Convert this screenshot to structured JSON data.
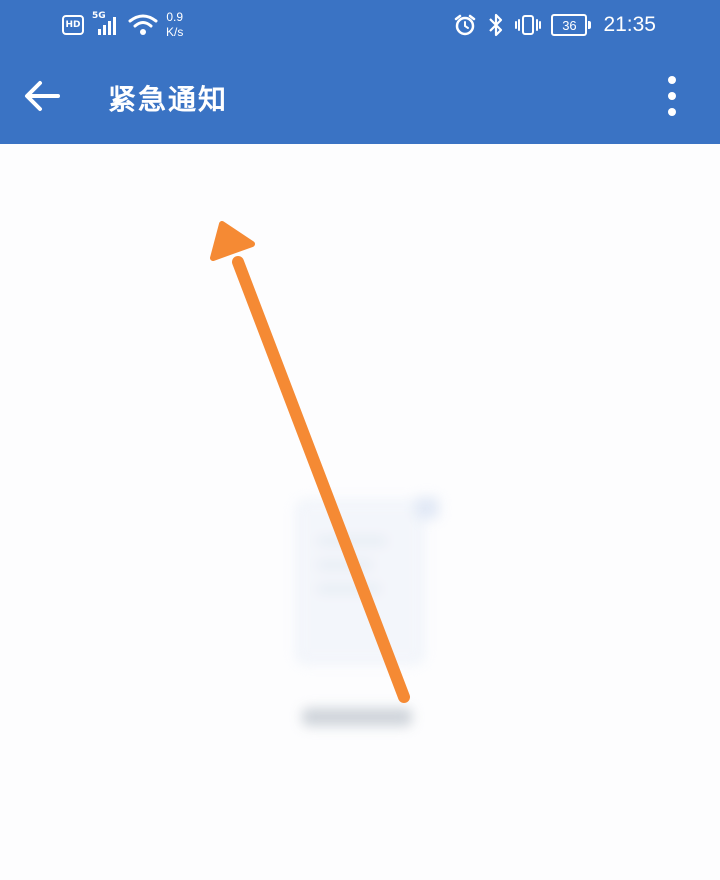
{
  "status_bar": {
    "hd_badge": "HD",
    "network_type": "5G",
    "net_speed_value": "0.9",
    "net_speed_unit": "K/s",
    "battery_level": "36",
    "time": "21:35",
    "icons": [
      "hd-icon",
      "signal-5g-icon",
      "wifi-icon",
      "alarm-icon",
      "bluetooth-icon",
      "vibrate-icon",
      "battery-icon"
    ]
  },
  "toolbar": {
    "title": "紧急通知",
    "back_icon": "arrow-left-icon",
    "more_icon": "more-vertical-icon"
  },
  "colors": {
    "header_bg": "#3a73c4",
    "content_bg": "#fdfdfe",
    "annotation_arrow": "#f58a34"
  }
}
